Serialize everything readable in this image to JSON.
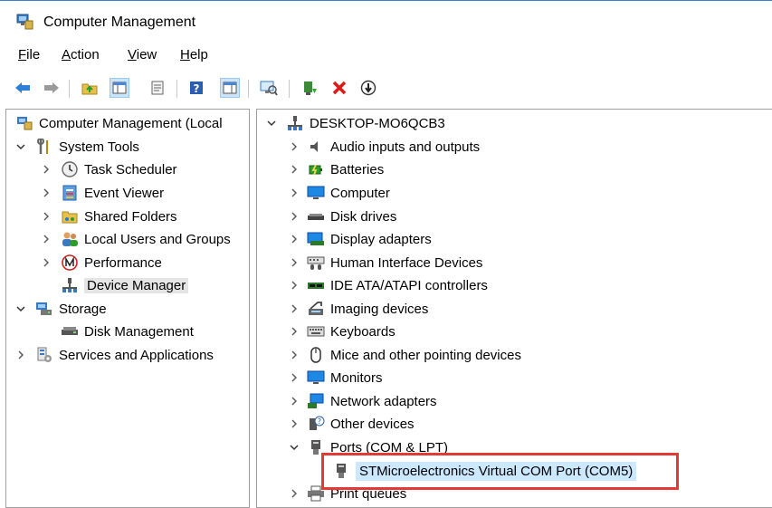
{
  "window": {
    "title": "Computer Management"
  },
  "menu": [
    {
      "id": "file",
      "label": "File"
    },
    {
      "id": "action",
      "label": "Action"
    },
    {
      "id": "view",
      "label": "View"
    },
    {
      "id": "help",
      "label": "Help"
    }
  ],
  "left_tree": {
    "root": "Computer Management (Local",
    "system_tools": "System Tools",
    "task_scheduler": "Task Scheduler",
    "event_viewer": "Event Viewer",
    "shared_folders": "Shared Folders",
    "local_users": "Local Users and Groups",
    "performance": "Performance",
    "device_manager": "Device Manager",
    "storage": "Storage",
    "disk_management": "Disk Management",
    "services": "Services and Applications"
  },
  "device_tree": {
    "computer": "DESKTOP-MO6QCB3",
    "categories": [
      "Audio inputs and outputs",
      "Batteries",
      "Computer",
      "Disk drives",
      "Display adapters",
      "Human Interface Devices",
      "IDE ATA/ATAPI controllers",
      "Imaging devices",
      "Keyboards",
      "Mice and other pointing devices",
      "Monitors",
      "Network adapters",
      "Other devices",
      "Ports (COM & LPT)"
    ],
    "port_device": "STMicroelectronics Virtual COM Port (COM5)",
    "after": "Print queues"
  },
  "colors": {
    "highlight": "#e53935",
    "selection": "#cce8ff",
    "accent": "#3c7fd1"
  }
}
